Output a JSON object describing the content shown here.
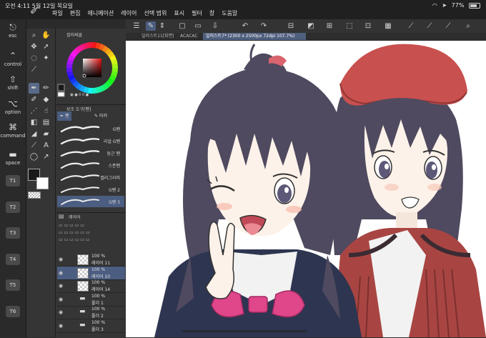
{
  "status": {
    "time": "오전 4:11",
    "date": "5월 12일 목요일",
    "battery": "77%"
  },
  "menu": [
    "파일",
    "편집",
    "애니메이션",
    "레이어",
    "선택 범위",
    "표시",
    "필터",
    "창",
    "도움말"
  ],
  "keys": [
    {
      "symbol": "⎋",
      "label": "esc"
    },
    {
      "symbol": "⌃",
      "label": "control"
    },
    {
      "symbol": "⇧",
      "label": "shift"
    },
    {
      "symbol": "⌥",
      "label": "option"
    },
    {
      "symbol": "⌘",
      "label": "command"
    },
    {
      "symbol": "▬",
      "label": "space"
    }
  ],
  "tkeys": [
    "T1",
    "T2",
    "T3",
    "T4",
    "T5",
    "T6"
  ],
  "color_panel": {
    "title": "컬러써클",
    "current_color": "#1a1a1a",
    "secondary_color": "#ffffff"
  },
  "sub_tool": {
    "title": "보조 도구[펜]",
    "tabs": [
      "펜",
      "마커"
    ],
    "brushes": [
      "G펜",
      "리얼 G펜",
      "둥근 펜",
      "스푼펜",
      "캘리그라피",
      "G펜 2",
      "G펜 3"
    ]
  },
  "layers": {
    "title": "레이어",
    "rows": [
      {
        "pct": "100 %",
        "name": "레이어 11",
        "type": "layer",
        "selected": false
      },
      {
        "pct": "100 %",
        "name": "레이어 10",
        "type": "layer",
        "selected": true
      },
      {
        "pct": "100 %",
        "name": "레이어 14",
        "type": "layer",
        "selected": false
      },
      {
        "pct": "100 %",
        "name": "폴더 1",
        "type": "folder",
        "selected": false
      },
      {
        "pct": "100 %",
        "name": "폴더 2",
        "type": "folder",
        "selected": false
      },
      {
        "pct": "100 %",
        "name": "폴더 3",
        "type": "folder",
        "selected": false
      }
    ]
  },
  "doc_tabs": [
    {
      "label": "일러스트11[화면]",
      "active": false
    },
    {
      "label": "ACACAC",
      "active": false
    },
    {
      "label": "일러스트7* (2300 x 2500px 72dpi 107.7%)",
      "active": true
    }
  ],
  "colors": {
    "hair": "#4f4a5f",
    "hair_shadow": "#3c3849",
    "beret": "#c8504e",
    "blazer": "#2e3550",
    "bow": "#e0468a",
    "vest": "#a84542"
  }
}
